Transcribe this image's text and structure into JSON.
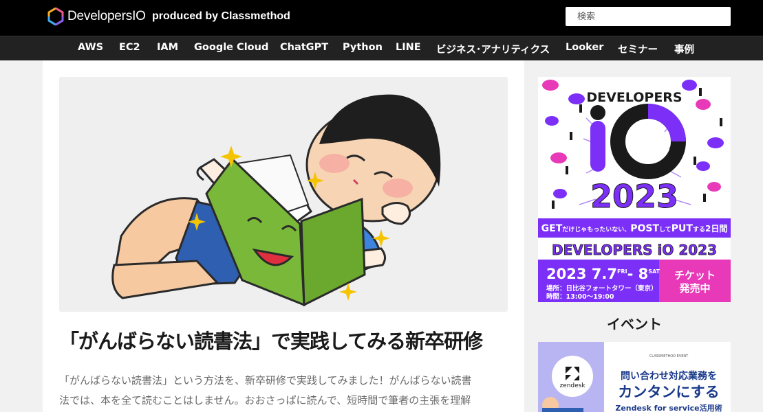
{
  "header": {
    "logo_text": "DevelopersIO",
    "produced_by": "produced by Classmethod",
    "search_placeholder": "検索"
  },
  "nav": {
    "items": [
      "AWS",
      "EC2",
      "IAM",
      "Google Cloud",
      "ChatGPT",
      "Python",
      "LINE",
      "ビジネス･アナリティクス",
      "Looker",
      "セミナー",
      "事例"
    ]
  },
  "article": {
    "title": "「がんばらない読書法」で実践してみる新卒研修",
    "excerpt_lines": [
      "「がんばらない読書法」という方法を、新卒研修で実践してみました！がんばらない読書",
      "法では、本を全て読むことはしません。おおさっぱに読んで、短時間で筆者の主張を理解"
    ],
    "hero_icon": "boy-reading-book-illustration"
  },
  "sidebar": {
    "banner": {
      "brand": "DEVELOPERS",
      "year": "2023",
      "tagline_1": "GET",
      "tagline_2": "だけじゃもったいない、",
      "tagline_3": "POST",
      "tagline_4": "して",
      "tagline_5": "PUT",
      "tagline_6": "する",
      "tagline_7": "2日間",
      "strip_title": "DEVELOPERS iO 2023",
      "date_main": "2023 7.7",
      "day1": "FRI",
      "date_sep": "- 8",
      "day2": "SAT",
      "venue": "場所：日比谷フォートタワー（東京）",
      "time": "時間：13:00～19:00",
      "ticket_1": "チケット",
      "ticket_2": "発売中",
      "colors": {
        "purple": "#7b2ff7",
        "magenta": "#e83ab8",
        "dark": "#1a1a1a"
      }
    },
    "event_heading": "イベント",
    "zendesk": {
      "brand": "zendesk",
      "label_small": "CLASSMETHOD EVENT",
      "line1": "問い合わせ対応業務を",
      "line2": "カンタンにする",
      "line3": "Zendesk for service活用術"
    }
  }
}
